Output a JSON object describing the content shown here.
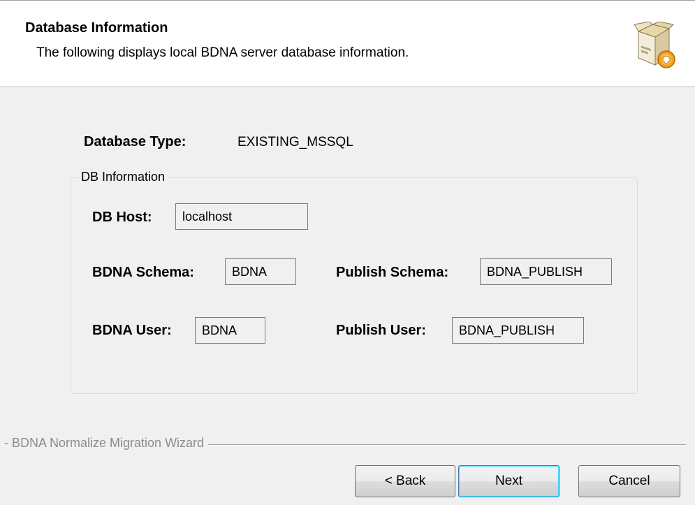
{
  "header": {
    "title": "Database Information",
    "subtitle": "The following displays local BDNA server database information."
  },
  "icons": {
    "header_icon": "software-box-install-icon"
  },
  "database_type": {
    "label": "Database Type:",
    "value": "EXISTING_MSSQL"
  },
  "db_information": {
    "group_label": "DB Information",
    "db_host": {
      "label": "DB Host:",
      "value": "localhost"
    },
    "bdna_schema": {
      "label": "BDNA Schema:",
      "value": "BDNA"
    },
    "publish_schema": {
      "label": "Publish Schema:",
      "value": "BDNA_PUBLISH"
    },
    "bdna_user": {
      "label": "BDNA User:",
      "value": "BDNA"
    },
    "publish_user": {
      "label": "Publish User:",
      "value": "BDNA_PUBLISH"
    }
  },
  "footer": {
    "wizard_name": "- BDNA Normalize Migration Wizard"
  },
  "buttons": {
    "back": "< Back",
    "next": "Next",
    "cancel": "Cancel"
  },
  "colors": {
    "background": "#f0f0f0",
    "header_background": "#ffffff",
    "default_button_border": "#3c7fb1"
  }
}
